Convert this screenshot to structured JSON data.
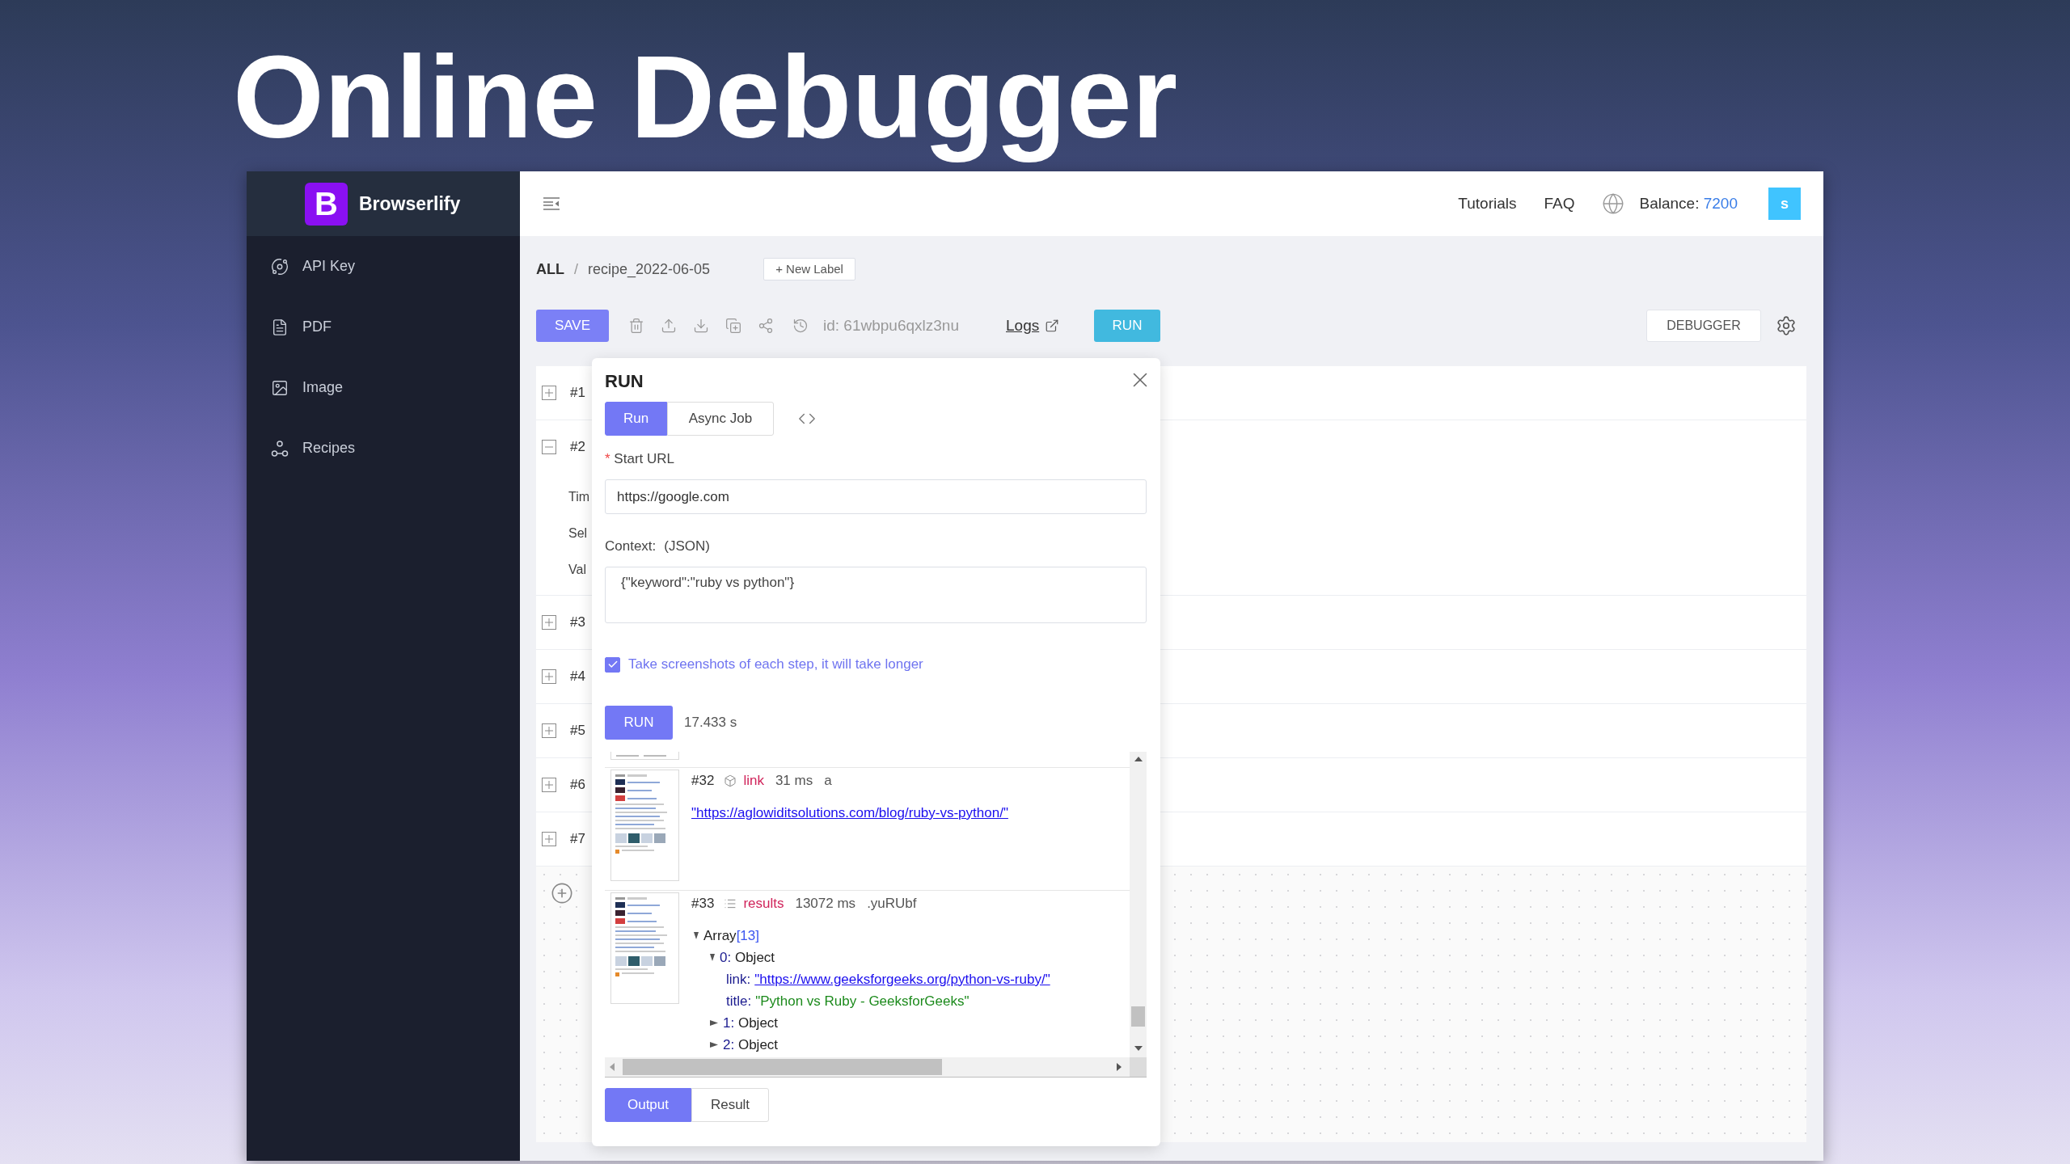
{
  "headline": "Online Debugger",
  "sidebar": {
    "logo_letter": "B",
    "brand": "Browserlify",
    "items": [
      {
        "label": "API Key",
        "kind": "api"
      },
      {
        "label": "PDF",
        "kind": "pdf"
      },
      {
        "label": "Image",
        "kind": "image"
      },
      {
        "label": "Recipes",
        "kind": "recipes"
      }
    ]
  },
  "top_bar": {
    "links": [
      "Tutorials",
      "FAQ"
    ],
    "balance_label": "Balance:",
    "balance_value": "7200",
    "avatar_letter": "s"
  },
  "breadcrumb": {
    "root": "ALL",
    "separator": "/",
    "current": "recipe_2022-06-05",
    "new_label_button": "+ New Label"
  },
  "toolbar": {
    "save_button": "SAVE",
    "recipe_id": "id: 61wbpu6qxlz3nu",
    "logs_link": "Logs",
    "run_button": "RUN",
    "debugger_button": "DEBUGGER"
  },
  "steps": [
    {
      "label": "#1",
      "expanded": false
    },
    {
      "label": "#2",
      "expanded": true,
      "fields": [
        "Tim",
        "Sel",
        "Val"
      ]
    },
    {
      "label": "#3",
      "expanded": false
    },
    {
      "label": "#4",
      "expanded": false
    },
    {
      "label": "#5",
      "expanded": false
    },
    {
      "label": "#6",
      "expanded": false
    },
    {
      "label": "#7",
      "expanded": false
    }
  ],
  "run_dialog": {
    "title": "RUN",
    "tabs": [
      {
        "label": "Run",
        "selected": true
      },
      {
        "label": "Async Job",
        "selected": false
      }
    ],
    "start_url": {
      "required_mark": "*",
      "label": "Start URL",
      "value": "https://google.com"
    },
    "context": {
      "label": "Context:",
      "hint": "(JSON)",
      "value": "{\"keyword\":\"ruby vs python\"}"
    },
    "screenshots_option": {
      "label": "Take screenshots of each step, it will take longer",
      "checked": true
    },
    "run_button": "RUN",
    "elapsed": "17.433 s",
    "log": [
      {
        "kind": "link",
        "number": "#32",
        "action": "link",
        "duration": "31 ms",
        "selector": "a",
        "value": "\"https://aglowiditsolutions.com/blog/ruby-vs-python/\""
      },
      {
        "kind": "tree",
        "number": "#33",
        "action": "results",
        "duration": "13072 ms",
        "selector": ".yuRUbf",
        "tree": [
          {
            "kind": "array",
            "label": "Array",
            "count": "[13]",
            "expanded": true,
            "children": [
              {
                "kind": "object",
                "key": "0:",
                "label": "Object",
                "expanded": true,
                "children": [
                  {
                    "kind": "link",
                    "key": "link:",
                    "value": "\"https://www.geeksforgeeks.org/python-vs-ruby/\""
                  },
                  {
                    "kind": "string",
                    "key": "title:",
                    "value": "\"Python vs Ruby - GeeksforGeeks\""
                  }
                ]
              },
              {
                "kind": "object",
                "key": "1:",
                "label": "Object",
                "expanded": false
              },
              {
                "kind": "object",
                "key": "2:",
                "label": "Object",
                "expanded": false
              }
            ]
          }
        ]
      }
    ],
    "output_tabs": [
      {
        "label": "Output",
        "selected": true
      },
      {
        "label": "Result",
        "selected": false
      }
    ]
  }
}
